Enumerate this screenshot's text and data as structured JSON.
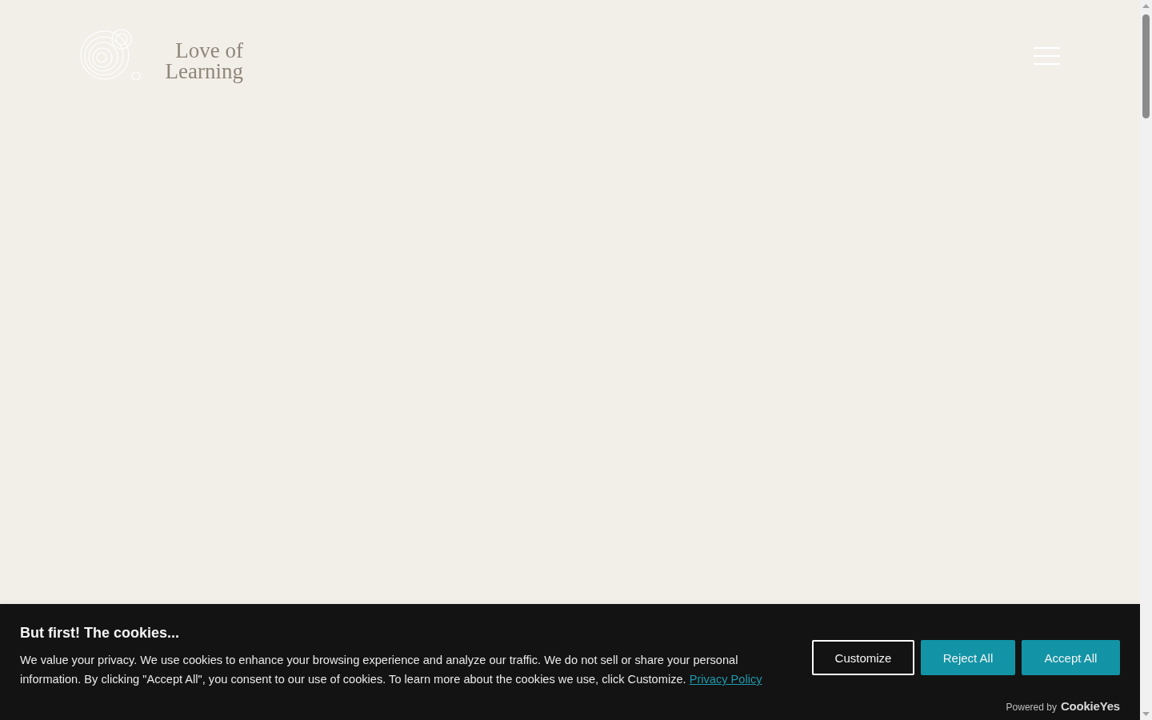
{
  "header": {
    "logo_text": "Love of Learning"
  },
  "cookie_banner": {
    "title": "But first! The cookies...",
    "message": "We value your privacy. We use cookies to enhance your browsing experience and analyze our traffic. We do not sell or share your personal information. By clicking \"Accept All\", you consent to our use of cookies. To learn more about the cookies we use, click Customize.",
    "link": "Privacy Policy",
    "buttons": [
      {
        "label": "Customize",
        "kind": "outline"
      },
      {
        "label": "Reject All",
        "kind": "filled"
      },
      {
        "label": "Accept All",
        "kind": "filled"
      }
    ],
    "powered_by": "Powered by",
    "brand": "CookieYes"
  }
}
